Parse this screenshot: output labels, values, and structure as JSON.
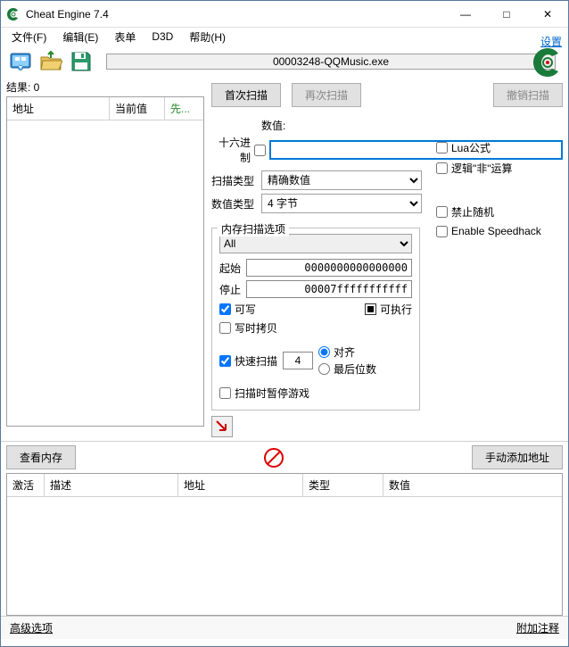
{
  "window": {
    "title": "Cheat Engine 7.4",
    "minimize": "—",
    "maximize": "□",
    "close": "✕"
  },
  "menu": {
    "file": "文件(F)",
    "edit": "编辑(E)",
    "table": "表单",
    "d3d": "D3D",
    "help": "帮助(H)"
  },
  "process_name": "00003248-QQMusic.exe",
  "settings_link": "设置",
  "results_label": "结果: 0",
  "result_columns": {
    "address": "地址",
    "current": "当前值",
    "previous": "先..."
  },
  "scan_buttons": {
    "first": "首次扫描",
    "next": "再次扫描",
    "undo": "撤销扫描"
  },
  "value_label": "数值:",
  "hex_label": "十六进制",
  "value_input": "",
  "scan_type_label": "扫描类型",
  "scan_type_value": "精确数值",
  "value_type_label": "数值类型",
  "value_type_value": "4 字节",
  "lua_formula": "Lua公式",
  "logic_not": "逻辑\"非\"运算",
  "disable_random": "禁止随机",
  "enable_speedhack": "Enable Speedhack",
  "mem_options": {
    "legend": "内存扫描选项",
    "region": "All",
    "start_label": "起始",
    "start_value": "0000000000000000",
    "stop_label": "停止",
    "stop_value": "00007fffffffffff",
    "writable": "可写",
    "executable": "可执行",
    "copy_on_write": "写时拷贝",
    "fast_scan": "快速扫描",
    "fast_value": "4",
    "align": "对齐",
    "last_digits": "最后位数",
    "pause_on_scan": "扫描时暂停游戏"
  },
  "mid_bar": {
    "view_mem": "查看内存",
    "add_manual": "手动添加地址"
  },
  "addr_columns": {
    "active": "激活",
    "desc": "描述",
    "address": "地址",
    "type": "类型",
    "value": "数值"
  },
  "bottom": {
    "adv": "高级选项",
    "comment": "附加注释"
  }
}
